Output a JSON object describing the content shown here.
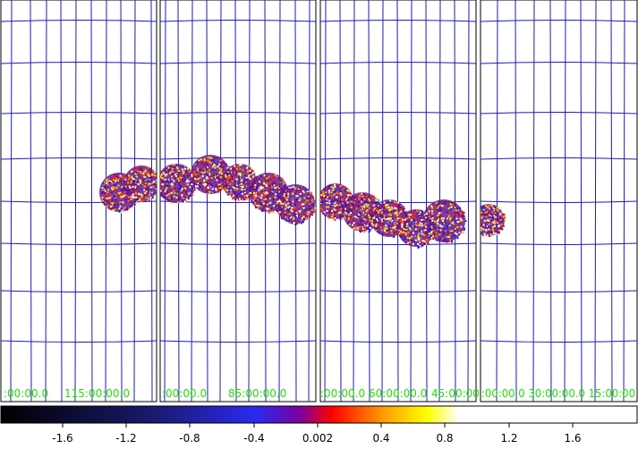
{
  "viewer": {
    "panels": [
      {
        "id": "panel-1",
        "coord_labels": [
          ":00:00.0",
          "115:00:00.0"
        ]
      },
      {
        "id": "panel-2",
        "coord_labels": [
          ":00:00.0",
          "85:00:00.0"
        ]
      },
      {
        "id": "panel-3",
        "coord_labels": [
          ":00:00.0",
          "60:00:00.0",
          "45:00:00"
        ]
      },
      {
        "id": "panel-4",
        "coord_labels": ":00:00.0 30:00:00.0 15:00:00"
      }
    ],
    "grid_color": "#1c1cb0",
    "label_color": "#22e000",
    "panel_border_color": "#000000"
  },
  "colorbar": {
    "tick_labels": [
      "-1.6",
      "-1.2",
      "-0.8",
      "-0.4",
      "0.002",
      "0.4",
      "0.8",
      "1.2",
      "1.6"
    ],
    "min": -2.0,
    "max": 2.0,
    "colormap_stops": [
      "#000000",
      "#1a1a6e",
      "#2a2af0",
      "#7a00a0",
      "#ff0000",
      "#ff9a00",
      "#ffff00",
      "#ffffff"
    ]
  }
}
